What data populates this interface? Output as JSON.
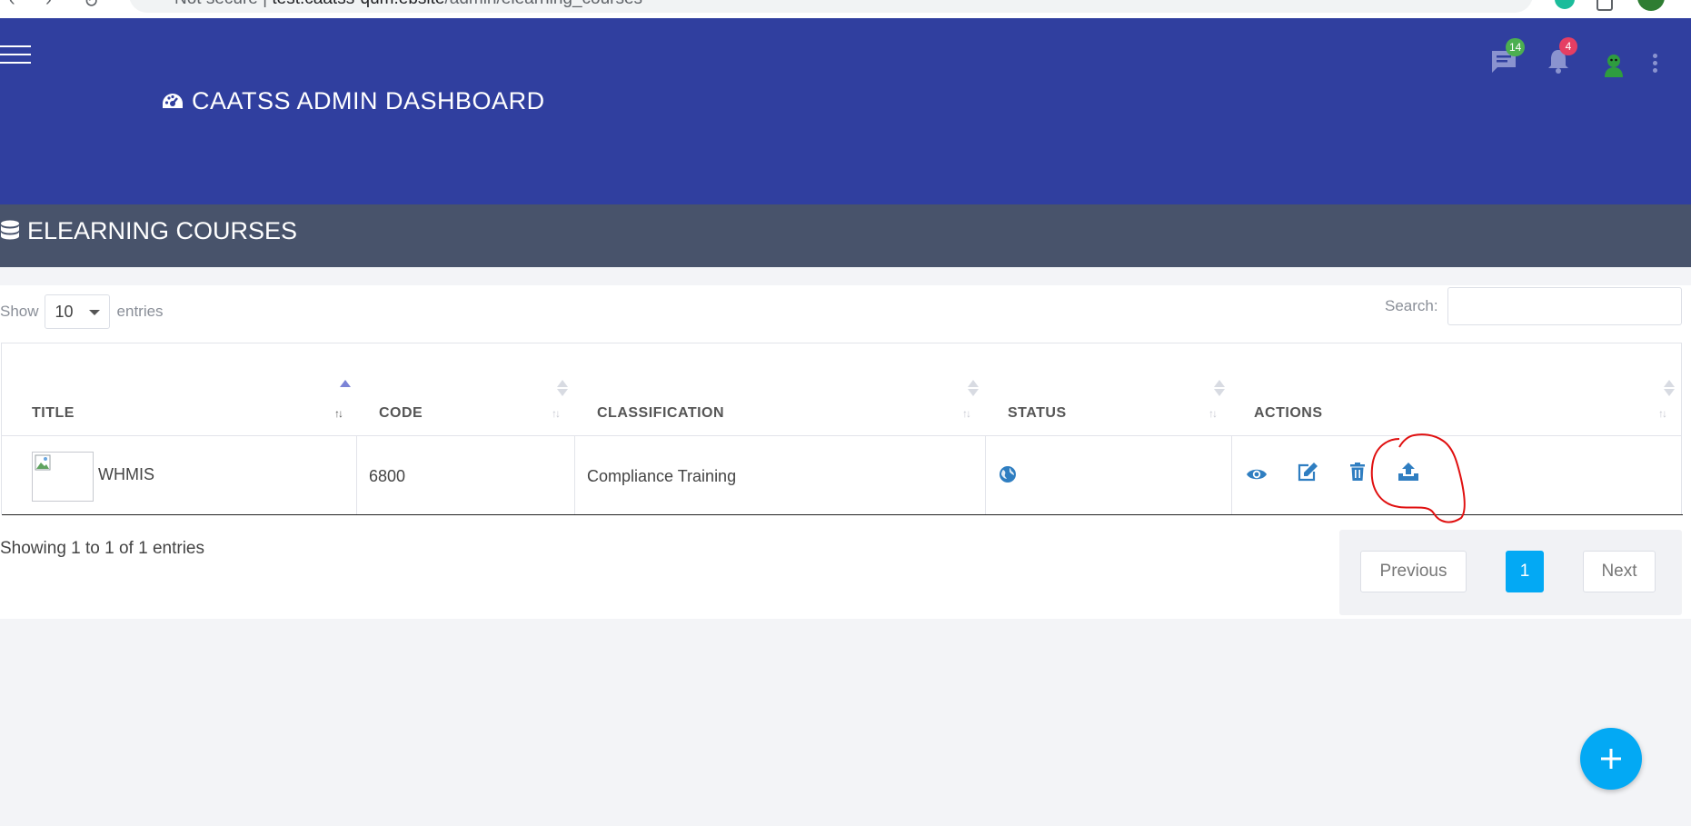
{
  "browser": {
    "url_prefix": "Not secure",
    "url_domain": "test.caatss-qum.ebsite",
    "url_path": "/admin/elearning_courses"
  },
  "header": {
    "brand": "CAATSS ADMIN DASHBOARD",
    "messages_count": "14",
    "notifications_count": "4",
    "badge_colors": {
      "messages": "#4caf50",
      "notifications": "#e53e63"
    },
    "icons": [
      "menu-icon",
      "dashboard-gauge-icon",
      "chat-icon",
      "bell-icon",
      "user-avatar-icon",
      "kebab-menu-icon"
    ]
  },
  "page": {
    "title": "ELEARNING COURSES",
    "title_icon": "database-icon"
  },
  "table_controls": {
    "show_label": "Show",
    "entries_value": "10",
    "entries_label": "entries",
    "search_label": "Search:",
    "search_value": ""
  },
  "table": {
    "columns": [
      "TITLE",
      "CODE",
      "CLASSIFICATION",
      "STATUS",
      "ACTIONS"
    ],
    "sorted_column": "TITLE",
    "sort_direction": "ascending",
    "rows": [
      {
        "title": "WHMIS",
        "code": "6800",
        "classification": "Compliance Training",
        "status_icon": "globe-icon",
        "actions": [
          "view-icon",
          "edit-icon",
          "delete-icon",
          "upload-icon"
        ]
      }
    ]
  },
  "footer": {
    "info": "Showing 1 to 1 of 1 entries",
    "previous": "Previous",
    "current_page": "1",
    "next": "Next"
  },
  "colors": {
    "header_bg": "#303f9f",
    "titlebar_bg": "#48536b",
    "accent": "#03a9f4",
    "action_icon": "#2f7ec1",
    "annotation": "#e01010"
  }
}
